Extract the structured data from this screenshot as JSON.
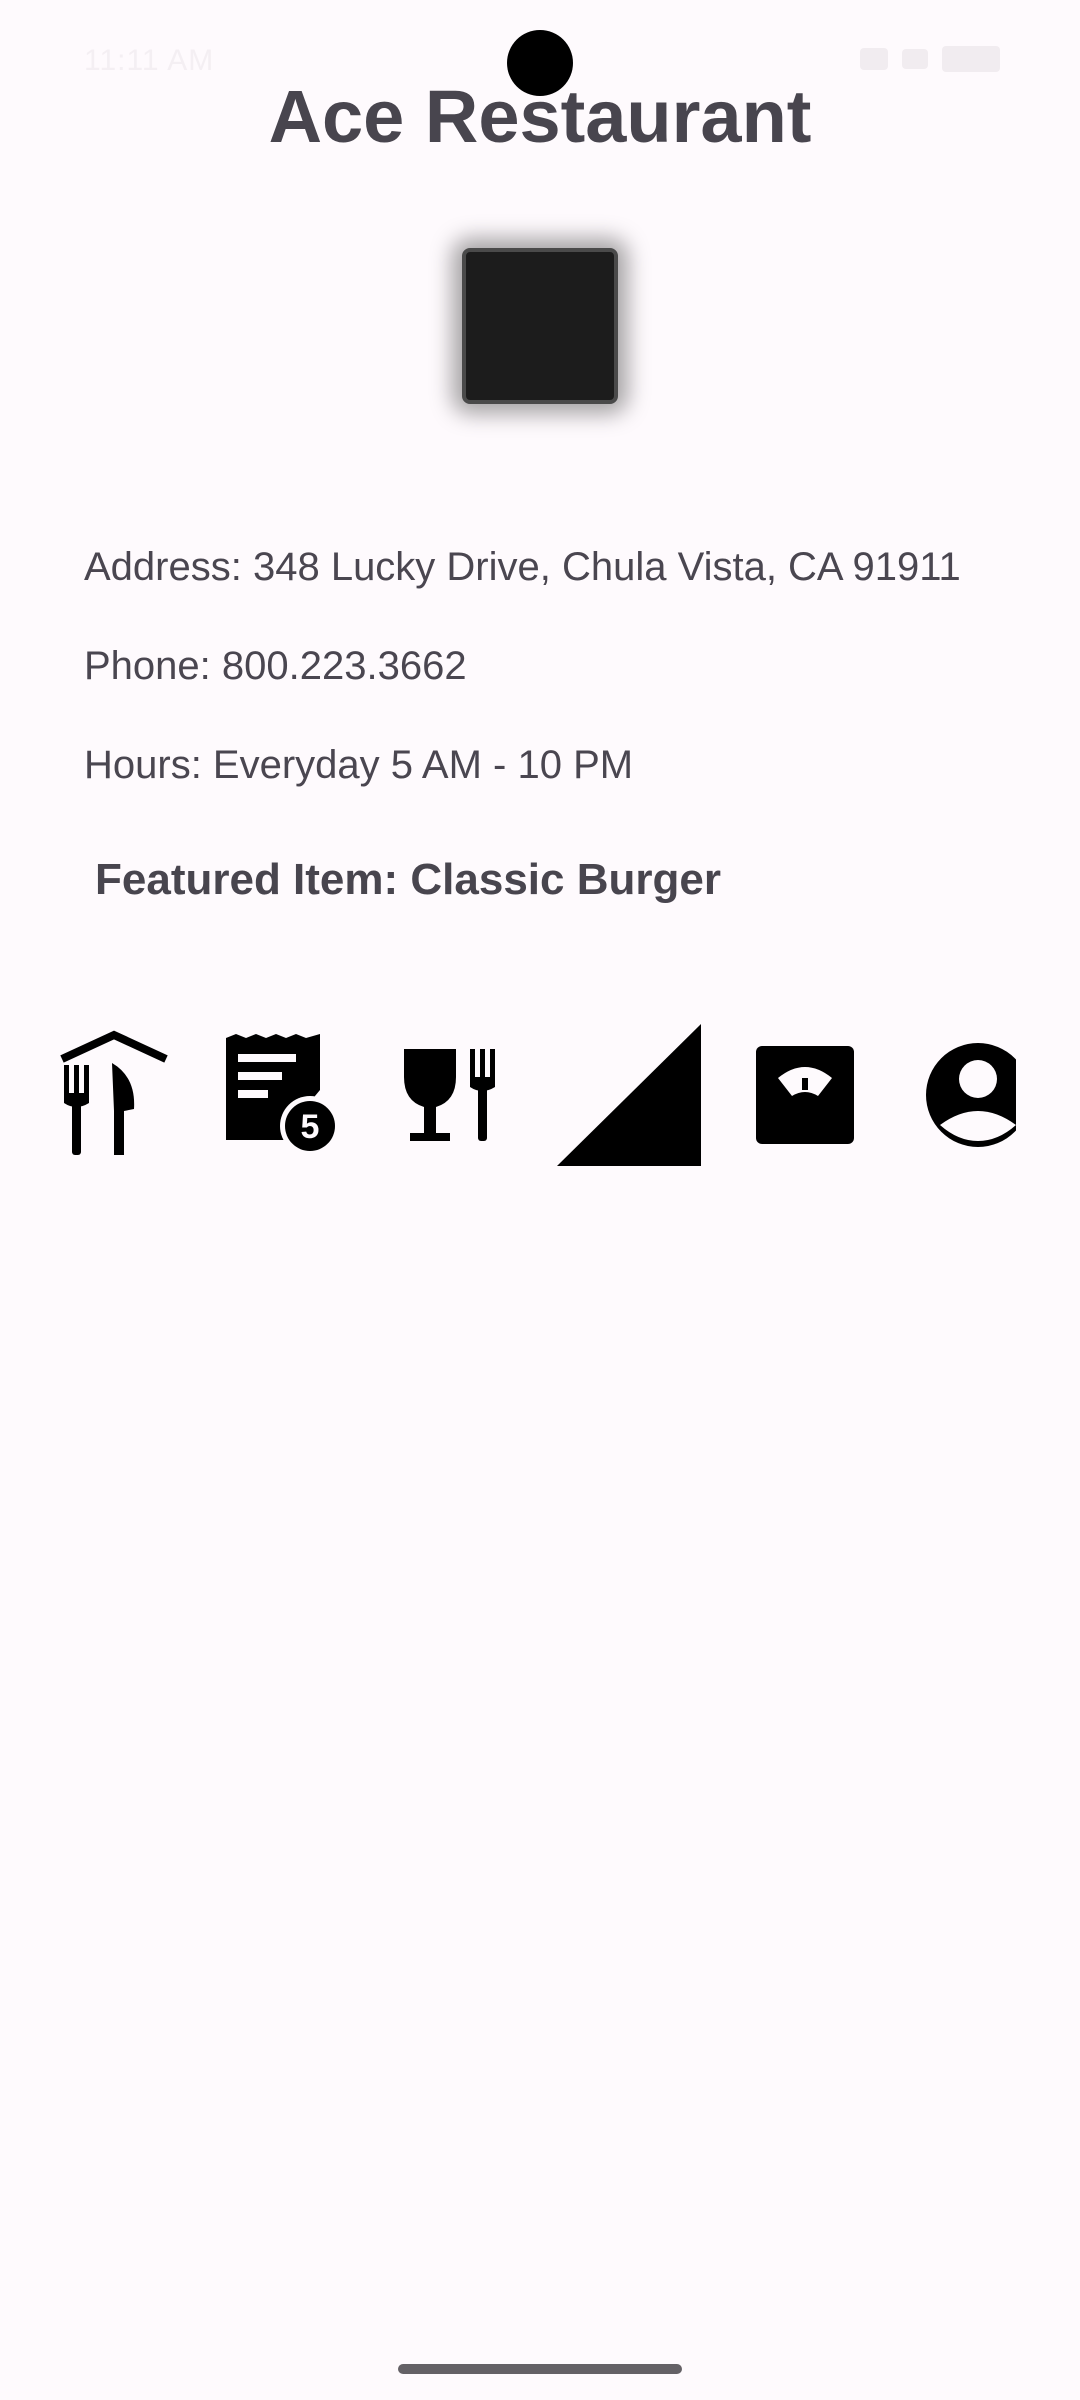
{
  "status_bar": {
    "time": "11:11 AM"
  },
  "restaurant": {
    "name": "Ace Restaurant",
    "address": "Address: 348 Lucky Drive, Chula Vista, CA 91911",
    "phone": "Phone: 800.223.3662",
    "hours": "Hours: Everyday 5 AM - 10 PM",
    "featured": "Featured Item: Classic Burger"
  },
  "nav_icons": [
    {
      "name": "restaurant-home-icon"
    },
    {
      "name": "receipt-badge-icon",
      "badge": "5"
    },
    {
      "name": "wine-dining-icon"
    },
    {
      "name": "signal-cellular-icon"
    },
    {
      "name": "scale-icon"
    },
    {
      "name": "account-circle-icon"
    }
  ],
  "colors": {
    "background": "#fefafd",
    "text_primary": "#48454e",
    "icon": "#000000"
  }
}
